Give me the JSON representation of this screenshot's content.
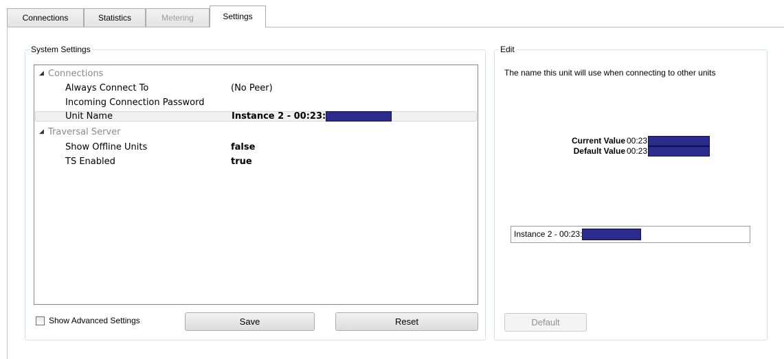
{
  "tabs": [
    {
      "label": "Connections",
      "state": "normal"
    },
    {
      "label": "Statistics",
      "state": "normal"
    },
    {
      "label": "Metering",
      "state": "disabled"
    },
    {
      "label": "Settings",
      "state": "active"
    }
  ],
  "system_settings": {
    "title": "System Settings",
    "tree": [
      {
        "type": "category",
        "label": "Connections"
      },
      {
        "type": "setting",
        "name": "Always Connect To",
        "value": "(No Peer)",
        "bold": false
      },
      {
        "type": "setting",
        "name": "Incoming Connection Password",
        "value": "",
        "bold": false
      },
      {
        "type": "setting",
        "name": "Unit Name",
        "value": "Instance 2 - 00:23:",
        "bold": true,
        "redacted": true,
        "selected": true
      },
      {
        "type": "category",
        "label": "Traversal Server"
      },
      {
        "type": "setting",
        "name": "Show Offline Units",
        "value": "false",
        "bold": true
      },
      {
        "type": "setting",
        "name": "TS Enabled",
        "value": "true",
        "bold": true
      }
    ],
    "show_advanced_label": "Show Advanced Settings",
    "show_advanced_checked": false,
    "save_label": "Save",
    "reset_label": "Reset"
  },
  "edit": {
    "title": "Edit",
    "description": "The name this unit will use when connecting to other units",
    "current_value_label": "Current Value",
    "current_value": "00:23",
    "default_value_label": "Default Value",
    "default_value": "00:23",
    "input_value": "Instance 2 - 00:23:",
    "default_button_label": "Default"
  },
  "colors": {
    "redaction": "#2b2b8e",
    "category_text": "#8a8a8a",
    "input_border": "#7a9cd3"
  }
}
